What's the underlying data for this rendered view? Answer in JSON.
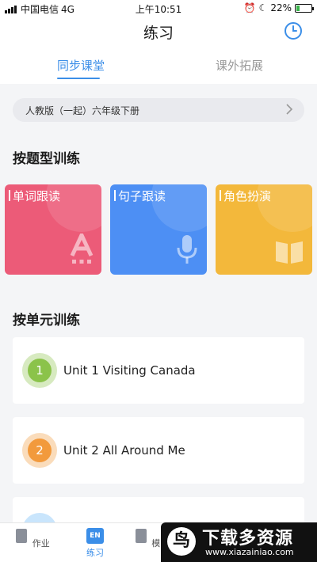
{
  "status_bar": {
    "carrier": "中国电信",
    "network": "4G",
    "time": "上午10:51",
    "battery_pct": "22%",
    "battery_level": 0.22
  },
  "header": {
    "title": "练习"
  },
  "tabs": [
    {
      "label": "同步课堂",
      "active": true
    },
    {
      "label": "课外拓展",
      "active": false
    }
  ],
  "textbook": {
    "label": "人教版（一起）六年级下册"
  },
  "sections": {
    "by_type": "按题型训练",
    "by_unit": "按单元训练"
  },
  "type_cards": [
    {
      "label": "单词跟读",
      "color": "#ec5b78",
      "icon": "letter-a-icon"
    },
    {
      "label": "句子跟读",
      "color": "#4d8ff4",
      "icon": "microphone-icon"
    },
    {
      "label": "角色扮演",
      "color": "#f3b83b",
      "icon": "open-book-icon"
    }
  ],
  "units": [
    {
      "number": "1",
      "title": "Unit 1 Visiting Canada",
      "color": "#8bc34a"
    },
    {
      "number": "2",
      "title": "Unit 2 All Around Me",
      "color": "#f29a3c"
    }
  ],
  "bottom_nav": [
    {
      "label": "作业",
      "icon": "homework-icon",
      "active": false
    },
    {
      "label": "练习",
      "icon": "en-practice-icon",
      "badge": "EN",
      "active": true
    },
    {
      "label": "模",
      "icon": "mock-icon",
      "active": false
    }
  ],
  "watermark": {
    "brand": "下载多资源",
    "url": "www.xiazainiao.com"
  },
  "colors": {
    "accent": "#3b8ee8",
    "background": "#f4f5f7"
  }
}
